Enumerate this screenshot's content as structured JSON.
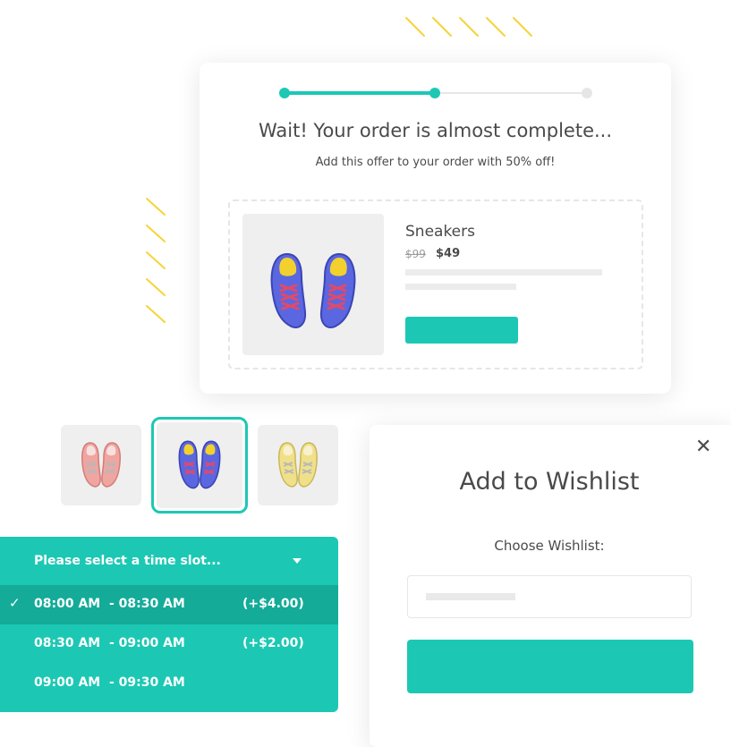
{
  "colors": {
    "accent": "#1cc8b4",
    "accent_dark": "#14ab99",
    "decoration_yellow": "#f6d438",
    "text": "#4a4a4a"
  },
  "offer": {
    "title": "Wait! Your order is almost complete...",
    "subtitle": "Add this offer to your order with 50% off!",
    "progress_steps_total": 3,
    "progress_steps_completed": 2,
    "product": {
      "name": "Sneakers",
      "old_price": "$99",
      "new_price": "$49",
      "image_icon": "sneakers-icon"
    }
  },
  "thumbnails": [
    {
      "icon": "sneakers-icon",
      "color": "pink",
      "selected": false
    },
    {
      "icon": "sneakers-icon",
      "color": "blue",
      "selected": true
    },
    {
      "icon": "sneakers-icon",
      "color": "yellow",
      "selected": false
    }
  ],
  "time_slot_dropdown": {
    "placeholder": "Please select a time slot...",
    "options": [
      {
        "time": "08:00 AM  - 08:30 AM",
        "price": "(+$4.00)",
        "selected": true
      },
      {
        "time": "08:30 AM  - 09:00 AM",
        "price": "(+$2.00)",
        "selected": false
      },
      {
        "time": "09:00 AM  - 09:30 AM",
        "price": "",
        "selected": false
      }
    ]
  },
  "wishlist_modal": {
    "title": "Add to Wishlist",
    "choose_label": "Choose Wishlist:",
    "close_icon": "close-icon",
    "close_glyph": "✕"
  }
}
